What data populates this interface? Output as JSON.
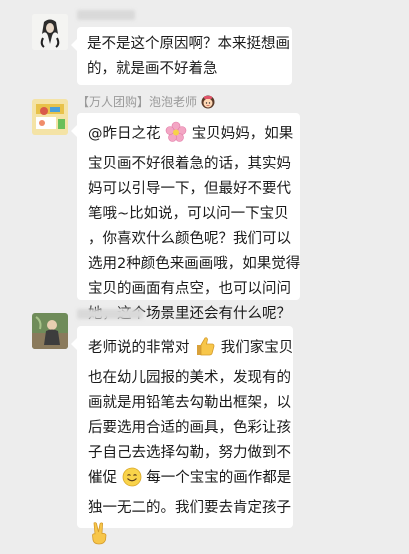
{
  "messages": [
    {
      "lines": [
        "是不是这个原因啊？本来挺想画",
        "的，就是画不好着急"
      ]
    },
    {
      "sender": "【万人团购】泡泡老师",
      "lines": [
        "@昨日之花",
        "宝贝妈妈，如果",
        "宝贝画不好很着急的话，其实妈",
        "妈可以引导一下，但最好不要代",
        "笔哦~比如说，可以问一下宝贝",
        "，你喜欢什么颜色呢？我们可以",
        "选用2种颜色来画画哦，如果觉得",
        "宝贝的画面有点空，也可以问问",
        "她，这个场景里还会有什么呢？"
      ]
    },
    {
      "lines": [
        "老师说的非常对",
        "我们家宝贝",
        "也在幼儿园报的美术，发现有的",
        "画就是用铅笔去勾勒出框架，以",
        "后要选用合适的画具，色彩让孩",
        "子自己去选择勾勒，努力做到不",
        "催促",
        "每一个宝宝的画作都是",
        "独一无二的。我们要去肯定孩子"
      ]
    }
  ],
  "icons": {
    "flower": "blossom-emoji",
    "girl": "girl-emoji",
    "thumb": "thumbs-up-emoji",
    "smile": "smile-emoji",
    "victory": "victory-hand-emoji"
  },
  "colors": {
    "background": "#ededed",
    "bubble": "#ffffff",
    "name": "#9a9a9a"
  }
}
